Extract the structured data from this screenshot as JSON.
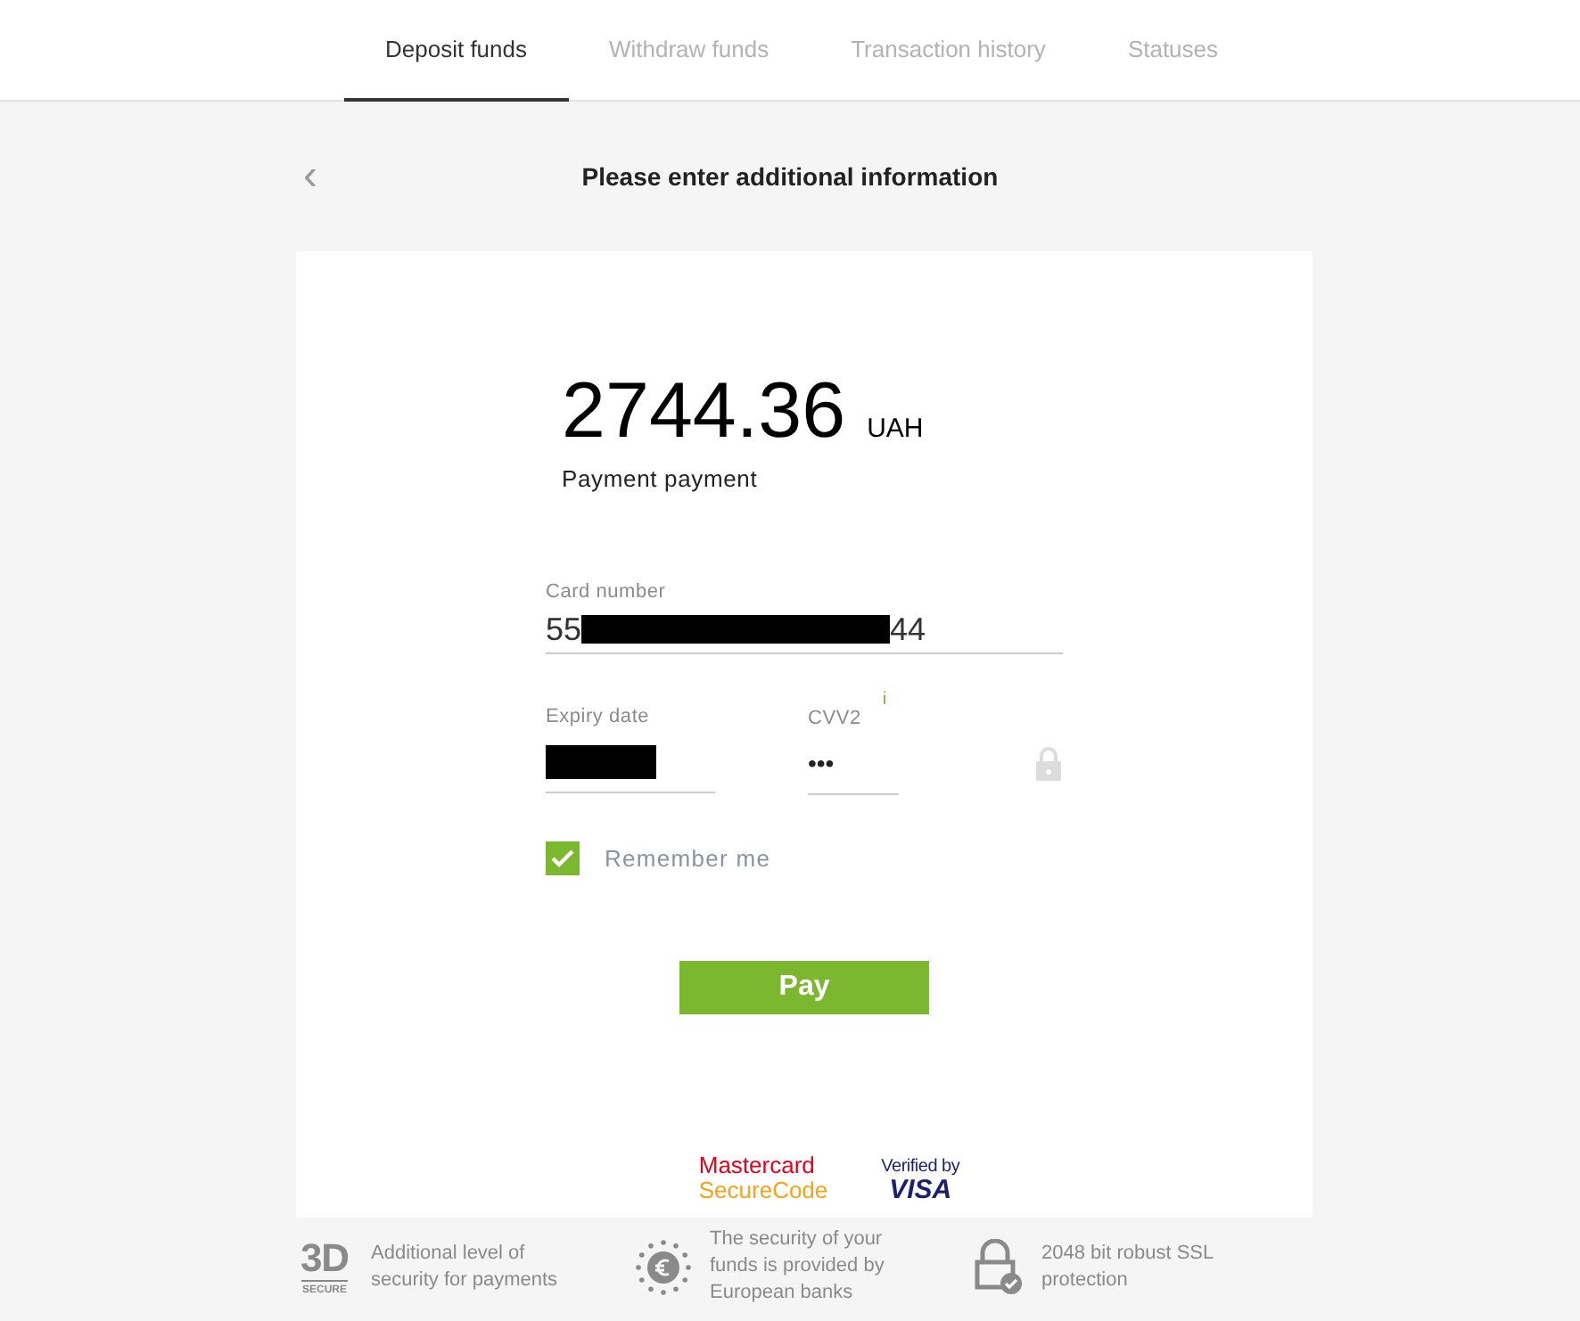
{
  "tabs": [
    {
      "label": "Deposit funds",
      "selected": true
    },
    {
      "label": "Withdraw funds",
      "selected": false
    },
    {
      "label": "Transaction history",
      "selected": false
    },
    {
      "label": "Statuses",
      "selected": false
    }
  ],
  "header": {
    "back": "‹",
    "title": "Please enter additional information"
  },
  "payment": {
    "amount": "2744.36",
    "currency": "UAH",
    "description": "Payment payment"
  },
  "card_number": {
    "label": "Card number",
    "value_start": "55",
    "value_end": "44",
    "redacted": true
  },
  "expiry_date": {
    "label": "Expiry date",
    "redacted": true
  },
  "cvv2": {
    "label": "CVV2",
    "info": "i",
    "value": "•••"
  },
  "remember_me": {
    "label": "Remember me",
    "checked": true
  },
  "pay_button": "Pay",
  "logos": {
    "mastercard": [
      "Mastercard",
      "SecureCode"
    ],
    "visa": [
      "Verified by",
      "VISA"
    ]
  },
  "features": [
    {
      "kind": "badge",
      "badge": [
        "3D",
        "SECURE"
      ],
      "text": "Additional level of security for payments"
    },
    {
      "kind": "euro",
      "text": "The security of your funds is provided by European banks"
    },
    {
      "kind": "lock",
      "text": "2048 bit robust SSL protection"
    }
  ]
}
